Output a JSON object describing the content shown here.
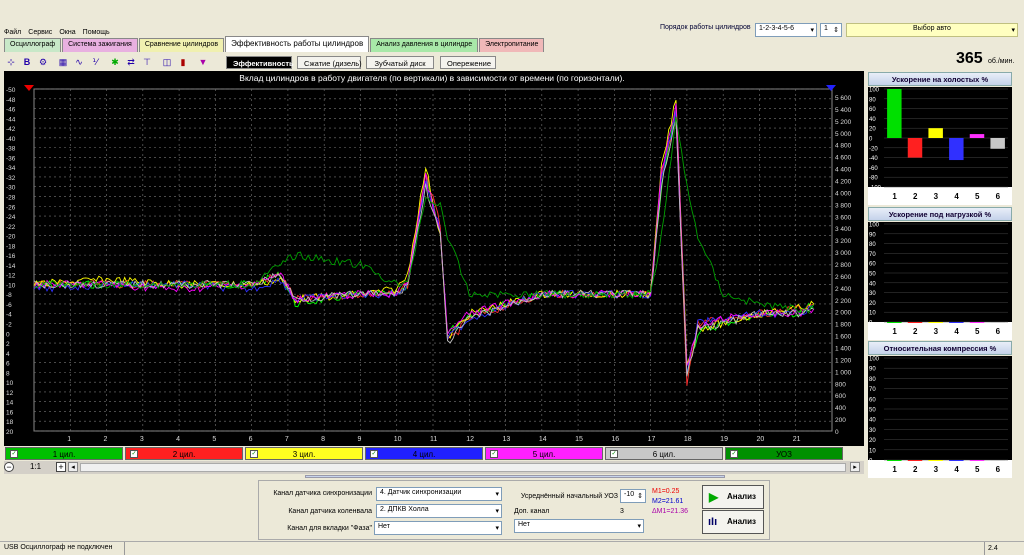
{
  "menu": [
    "Файл",
    "Сервис",
    "Окна",
    "Помощь"
  ],
  "cylinder_order": {
    "label": "Порядок работы цилиндров",
    "value": "1-2-3-4-5-6",
    "spin": "1"
  },
  "car_select": "Выбор авто",
  "tabs": [
    {
      "label": "Осциллограф",
      "color": "#c8e8c8"
    },
    {
      "label": "Система зажигания",
      "color": "#e8b0e0"
    },
    {
      "label": "Сравнение цилиндров",
      "color": "#f0f0b0"
    },
    {
      "label": "Эффективность работы цилиндров",
      "color": "#ffffff"
    },
    {
      "label": "Анализ давления в цилиндре",
      "color": "#a8e8a8"
    },
    {
      "label": "Электропитание",
      "color": "#f0b8b8"
    }
  ],
  "subtabs": [
    "Эффективность",
    "Сжатие (дизель)",
    "Зубчатый диск",
    "Опережение"
  ],
  "rpm": {
    "value": "365",
    "unit": "об./мин."
  },
  "chart": {
    "title": "Вклад цилиндров в работу двигателя (по вертикали) в зависимости от времени (по горизонтали)."
  },
  "chart_data": {
    "type": "line",
    "title": "Вклад цилиндров в работу двигателя (по вертикали) в зависимости от времени (по горизонтали).",
    "x_ticks": [
      "1",
      "2",
      "3",
      "4",
      "5",
      "6",
      "7",
      "8",
      "9",
      "10",
      "11",
      "12",
      "13",
      "14",
      "15",
      "16",
      "17",
      "18",
      "19",
      "20",
      "21"
    ],
    "y_left_ticks": [
      "-50",
      "-48",
      "-46",
      "-44",
      "-42",
      "-40",
      "-38",
      "-36",
      "-34",
      "-32",
      "-30",
      "-28",
      "-26",
      "-24",
      "-22",
      "-20",
      "-18",
      "-16",
      "-14",
      "-12",
      "-10",
      "-8",
      "-6",
      "-4",
      "-2",
      "0",
      "2",
      "4",
      "6",
      "8",
      "10",
      "12",
      "14",
      "16",
      "18",
      "20"
    ],
    "y_right_ticks": [
      "5 600",
      "5 400",
      "5 200",
      "5 000",
      "4 800",
      "4 600",
      "4 400",
      "4 200",
      "4 000",
      "3 800",
      "3 600",
      "3 400",
      "3 200",
      "3 000",
      "2 800",
      "2 600",
      "2 400",
      "2 200",
      "2 000",
      "1 800",
      "1 600",
      "1 400",
      "1 200",
      "1 000",
      "800",
      "600",
      "400",
      "200",
      "0"
    ],
    "xlim": [
      0,
      22
    ],
    "ylim": [
      -50,
      20
    ],
    "grid": true,
    "x": [
      0,
      2,
      4,
      6,
      6.8,
      7.2,
      9,
      10,
      10.3,
      10.8,
      11.2,
      11.4,
      12,
      14,
      16,
      17,
      17.3,
      17.7,
      18,
      18.3,
      19,
      20,
      21,
      21.5
    ],
    "series": [
      {
        "name": "1 цил.",
        "color": "#00ff00",
        "values": [
          -10,
          -10,
          -10,
          -10,
          -12,
          -6,
          -8,
          -8,
          -10,
          -32,
          -20,
          0,
          -4,
          -8,
          -8,
          -8,
          -30,
          -46,
          8,
          0,
          -2,
          -4,
          -4,
          -6
        ]
      },
      {
        "name": "2 цил.",
        "color": "#ff3030",
        "values": [
          -10,
          -10,
          -10,
          -10,
          -12,
          -7,
          -8,
          -8,
          -10,
          -33,
          -22,
          2,
          -3,
          -8,
          -8,
          -8,
          -32,
          -44,
          10,
          -2,
          -3,
          -4,
          -5,
          -6
        ]
      },
      {
        "name": "3 цил.",
        "color": "#ffff00",
        "values": [
          -10,
          -11,
          -10,
          -10,
          -11,
          -7,
          -8,
          -9,
          -12,
          -34,
          -20,
          1,
          -4,
          -8,
          -8,
          -8,
          -34,
          -48,
          6,
          -1,
          -2,
          -4,
          -5,
          -6
        ]
      },
      {
        "name": "4 цил.",
        "color": "#3030ff",
        "values": [
          -9,
          -10,
          -10,
          -9,
          -11,
          -7,
          -8,
          -8,
          -10,
          -31,
          -21,
          1,
          -3,
          -8,
          -8,
          -8,
          -32,
          -45,
          8,
          -2,
          -3,
          -4,
          -4,
          -5
        ]
      },
      {
        "name": "5 цил.",
        "color": "#ff00ff",
        "values": [
          -10,
          -10,
          -9,
          -10,
          -12,
          -7,
          -8,
          -8,
          -11,
          -32,
          -20,
          0,
          -4,
          -8,
          -8,
          -8,
          -33,
          -47,
          7,
          -1,
          -3,
          -4,
          -4,
          -5
        ]
      },
      {
        "name": "6 цил.",
        "color": "#c0c0c0",
        "values": [
          -10,
          -10,
          -10,
          -10,
          -12,
          -7,
          -8,
          -8,
          -10,
          -30,
          -20,
          2,
          -3,
          -8,
          -8,
          -8,
          -30,
          -44,
          9,
          -1,
          -2,
          -4,
          -4,
          -5
        ]
      },
      {
        "name": "УОЗ",
        "color": "#00a000",
        "values": [
          -10,
          -10,
          -10,
          -10,
          -14,
          -16,
          -14,
          -10,
          -10,
          -28,
          -26,
          -20,
          -8,
          -8,
          -8,
          -8,
          -20,
          -44,
          -30,
          -20,
          -8,
          -6,
          -5,
          -5
        ]
      }
    ]
  },
  "legend": [
    {
      "label": "1 цил.",
      "color": "#00c000"
    },
    {
      "label": "2 цил.",
      "color": "#ff2020"
    },
    {
      "label": "3 цил.",
      "color": "#ffff20"
    },
    {
      "label": "4 цил.",
      "color": "#2020ff"
    },
    {
      "label": "5 цил.",
      "color": "#ff20ff"
    },
    {
      "label": "6 цил.",
      "color": "#c8c8c8"
    },
    {
      "label": "УОЗ",
      "color": "#009000"
    }
  ],
  "zoom": "1:1",
  "side_charts": [
    {
      "title": "Ускорение на холостых %",
      "ticks": [
        "100",
        "80",
        "60",
        "40",
        "20",
        "0",
        "-20",
        "-40",
        "-60",
        "-80",
        "-100"
      ],
      "ymin": -100,
      "ymax": 100,
      "values": [
        100,
        -40,
        20,
        -45,
        8,
        -22
      ],
      "colors": [
        "#00e000",
        "#ff2020",
        "#ffff00",
        "#3030ff",
        "#ff30ff",
        "#c8c8c8"
      ],
      "x": [
        "1",
        "2",
        "3",
        "4",
        "5",
        "6"
      ]
    },
    {
      "title": "Ускорение под нагрузкой %",
      "ticks": [
        "100",
        "90",
        "80",
        "70",
        "60",
        "50",
        "40",
        "30",
        "20",
        "10",
        "0"
      ],
      "ymin": 0,
      "ymax": 100,
      "values": [
        0,
        0,
        0,
        0,
        0,
        0
      ],
      "colors": [
        "#00e000",
        "#ff2020",
        "#ffff00",
        "#3030ff",
        "#ff30ff",
        "#c8c8c8"
      ],
      "x": [
        "1",
        "2",
        "3",
        "4",
        "5",
        "6"
      ]
    },
    {
      "title": "Относительная компрессия %",
      "ticks": [
        "100",
        "90",
        "80",
        "70",
        "60",
        "50",
        "40",
        "30",
        "20",
        "10",
        "0"
      ],
      "ymin": 0,
      "ymax": 100,
      "values": [
        0,
        0,
        0,
        0,
        0,
        0
      ],
      "colors": [
        "#00e000",
        "#ff2020",
        "#ffff00",
        "#3030ff",
        "#ff30ff",
        "#c8c8c8"
      ],
      "x": [
        "1",
        "2",
        "3",
        "4",
        "5",
        "6"
      ]
    }
  ],
  "bottom": {
    "sync_label": "Канал датчика синхронизации",
    "sync_value": "4. Датчик синхронизации",
    "crank_label": "Канал датчика коленвала",
    "crank_value": "2. ДПКВ Холла",
    "phase_label": "Канал для вкладки \"Фаза\"",
    "phase_value": "Нет",
    "uoz_label": "Усреднённый начальный УОЗ",
    "uoz_value": "-10",
    "extra_label": "Доп. канал",
    "extra_num": "3",
    "extra_value": "Нет",
    "m1": "M1=0.25",
    "m2": "M2=21.61",
    "dm": "ΔM1=21.36",
    "btn1": "Анализ",
    "btn2": "Анализ"
  },
  "status": {
    "left": "USB Осциллограф не подключен",
    "right": "2.4"
  }
}
